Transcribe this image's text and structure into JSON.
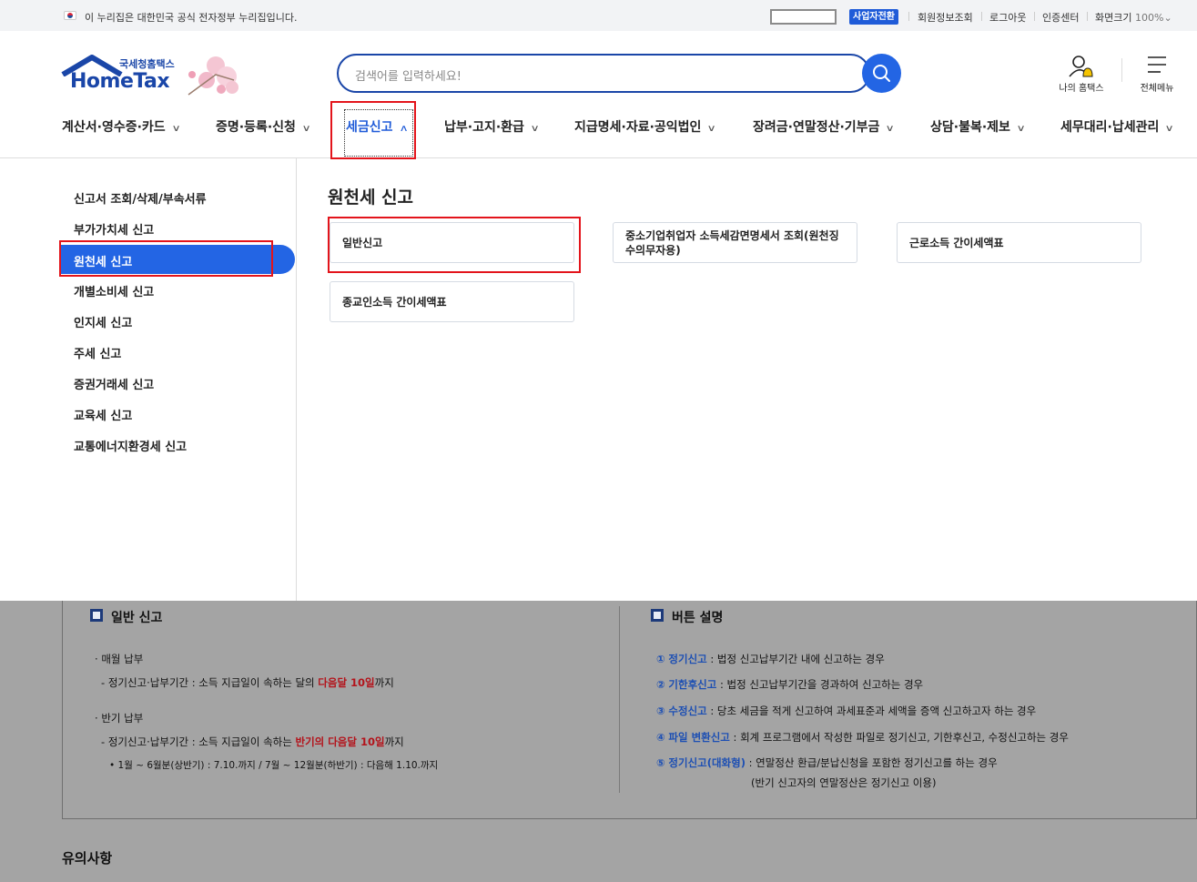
{
  "gov_bar": {
    "notice": "이 누리집은 대한민국 공식 전자정부 누리집입니다.",
    "biz_switch": "사업자전환",
    "links": [
      "회원정보조회",
      "로그아웃",
      "인증센터"
    ],
    "screen_size_label": "화면크기",
    "screen_size_value": "100%"
  },
  "header": {
    "logo_small": "국세청홈택스",
    "logo_big": "HomeTax",
    "search_placeholder": "검색어를 입력하세요!",
    "my_hometax": "나의 홈택스",
    "all_menu": "전체메뉴"
  },
  "gnb": {
    "items": [
      "계산서·영수증·카드",
      "증명·등록·신청",
      "세금신고",
      "납부·고지·환급",
      "지급명세·자료·공익법인",
      "장려금·연말정산·기부금",
      "상담·불복·제보",
      "세무대리·납세관리"
    ],
    "active_index": 2
  },
  "submenu": {
    "items": [
      "신고서 조회/삭제/부속서류",
      "부가가치세 신고",
      "원천세 신고",
      "개별소비세 신고",
      "인지세 신고",
      "주세 신고",
      "증권거래세 신고",
      "교육세 신고",
      "교통에너지환경세 신고"
    ],
    "active_index": 2
  },
  "content": {
    "title": "원천세 신고",
    "cards": [
      "일반신고",
      "중소기업취업자 소득세감면명세서 조회(원천징수의무자용)",
      "근로소득 간이세액표",
      "종교인소득 간이세액표"
    ]
  },
  "background": {
    "general_title": "일반 신고",
    "monthly": "매월 납부",
    "monthly_period_prefix": "정기신고·납부기간 : 소득 지급일이 속하는 달의 ",
    "monthly_period_highlight": "다음달 10일",
    "monthly_period_suffix": "까지",
    "semi": "반기 납부",
    "semi_period_prefix": "정기신고·납부기간 : 소득 지급일이 속하는 ",
    "semi_period_highlight": "반기의 다음달 10일",
    "semi_period_suffix": "까지",
    "semi_detail": "1월 ~ 6월분(상반기) : 7.10.까지 / 7월 ~ 12월분(하반기) : 다음해 1.10.까지",
    "button_title": "버튼 설명",
    "buttons": [
      {
        "num": "①",
        "name": "정기신고",
        "desc": " : 법정 신고납부기간 내에 신고하는 경우"
      },
      {
        "num": "②",
        "name": "기한후신고",
        "desc": " : 법정 신고납부기간을 경과하여 신고하는 경우"
      },
      {
        "num": "③",
        "name": "수정신고",
        "desc": " : 당초 세금을 적게 신고하여 과세표준과 세액을 증액 신고하고자 하는 경우"
      },
      {
        "num": "④",
        "name": "파일 변환신고",
        "desc": " : 회계 프로그램에서 작성한 파일로 정기신고, 기한후신고, 수정신고하는 경우"
      },
      {
        "num": "⑤",
        "name": "정기신고(대화형)",
        "desc": " : 연말정산 환급/분납신청을 포함한 정기신고를 하는 경우"
      }
    ],
    "button5_extra": "(반기 신고자의 연말정산은 정기신고 이용)",
    "notice_title": "유의사항"
  },
  "colors": {
    "brand": "#1a46a8",
    "accent": "#2365e4",
    "highlight_box": "#e3141b"
  }
}
